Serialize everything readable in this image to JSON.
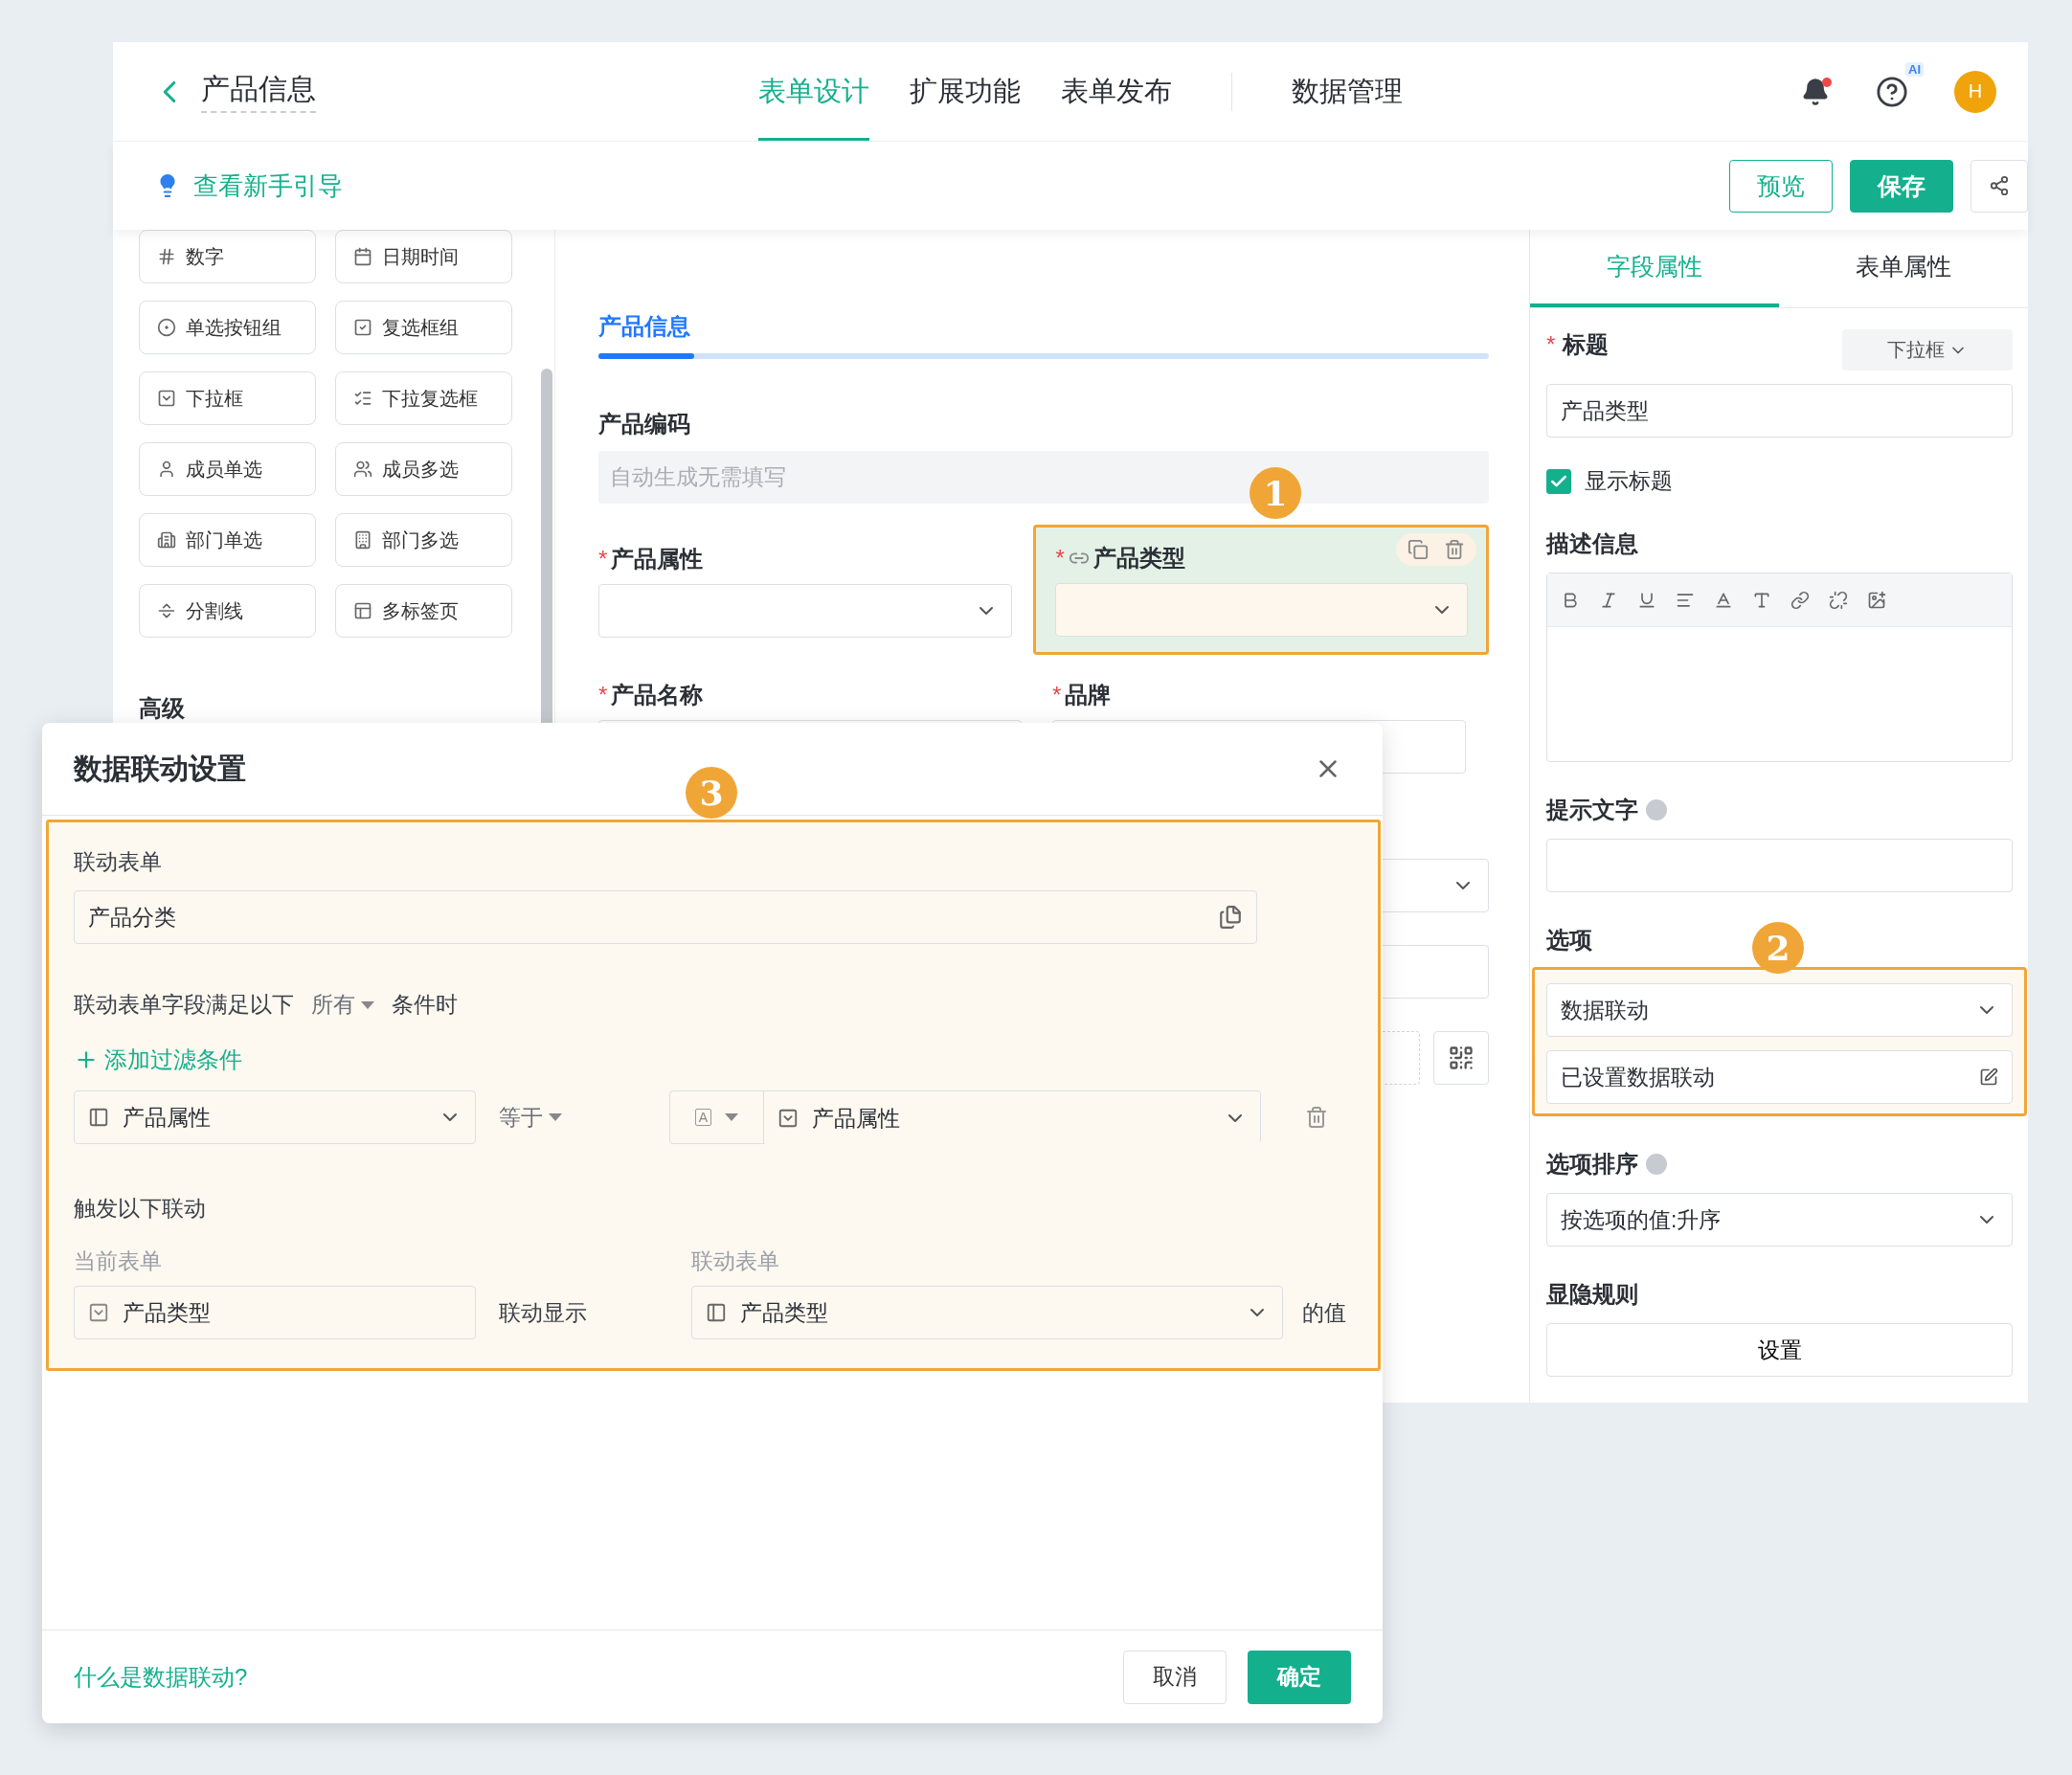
{
  "header": {
    "title": "产品信息",
    "tabs": [
      {
        "label": "表单设计",
        "selected": true
      },
      {
        "label": "扩展功能",
        "selected": false
      },
      {
        "label": "表单发布",
        "selected": false
      },
      {
        "label": "数据管理",
        "selected": false
      }
    ],
    "ai_badge": "AI",
    "avatar": "H"
  },
  "toolbar": {
    "guide_link": "查看新手引导",
    "buttons": [
      {
        "label": "预览",
        "kind": "outline"
      },
      {
        "label": "保存",
        "kind": "primary"
      }
    ]
  },
  "palette": {
    "items": [
      {
        "label": "数字",
        "kind": "number"
      },
      {
        "label": "日期时间",
        "kind": "datetime"
      },
      {
        "label": "单选按钮组",
        "kind": "radio"
      },
      {
        "label": "复选框组",
        "kind": "checkbox"
      },
      {
        "label": "下拉框",
        "kind": "dropdown"
      },
      {
        "label": "下拉复选框",
        "kind": "multi_dropdown"
      },
      {
        "label": "成员单选",
        "kind": "member"
      },
      {
        "label": "成员多选",
        "kind": "members"
      },
      {
        "label": "部门单选",
        "kind": "dept"
      },
      {
        "label": "部门多选",
        "kind": "depts"
      },
      {
        "label": "分割线",
        "kind": "divider"
      },
      {
        "label": "多标签页",
        "kind": "tabs"
      }
    ],
    "section_title": "高级"
  },
  "canvas": {
    "section_title": "产品信息",
    "code_field": {
      "label": "产品编码",
      "placeholder": "自动生成无需填写"
    },
    "fields": [
      {
        "label": "产品属性",
        "required_mark": "*",
        "selected": false,
        "linked": false
      },
      {
        "label": "产品类型",
        "required_mark": "*",
        "selected": true,
        "linked": true
      }
    ],
    "next_labels": [
      {
        "label": "产品名称",
        "required_mark": "*"
      },
      {
        "label": "品牌",
        "required_mark": "*"
      }
    ]
  },
  "properties": {
    "tabs": [
      {
        "label": "字段属性",
        "selected": true
      },
      {
        "label": "表单属性",
        "selected": false
      }
    ],
    "title_label": "标题",
    "title_mark": "*",
    "type_select": "下拉框",
    "title_value": "产品类型",
    "show_title": {
      "label": "显示标题",
      "checked": true
    },
    "description_label": "描述信息",
    "hint_label": "提示文字",
    "options_label": "选项",
    "options_source": "数据联动",
    "options_status": "已设置数据联动",
    "sort_label": "选项排序",
    "sort_value": "按选项的值:升序",
    "visibility_label": "显隐规则",
    "visibility_button": "设置"
  },
  "dialog": {
    "title": "数据联动设置",
    "linked_form_label": "联动表单",
    "linked_form": "产品分类",
    "condition_prefix": "联动表单字段满足以下",
    "condition_mode": "所有",
    "condition_suffix": "条件时",
    "add_filter": "添加过滤条件",
    "filter": {
      "field": "产品属性",
      "operator": "等于",
      "value_type": "A",
      "value": "产品属性"
    },
    "trigger_label": "触发以下联动",
    "current_form_label": "当前表单",
    "target_form_label": "联动表单",
    "current_field": "产品类型",
    "action": "联动显示",
    "target_field": "产品类型",
    "suffix": "的值",
    "help_link": "什么是数据联动?",
    "buttons": [
      {
        "label": "取消",
        "kind": "outline"
      },
      {
        "label": "确定",
        "kind": "primary"
      }
    ]
  },
  "annotations": [
    {
      "label": "1"
    },
    {
      "label": "2"
    },
    {
      "label": "3"
    }
  ]
}
